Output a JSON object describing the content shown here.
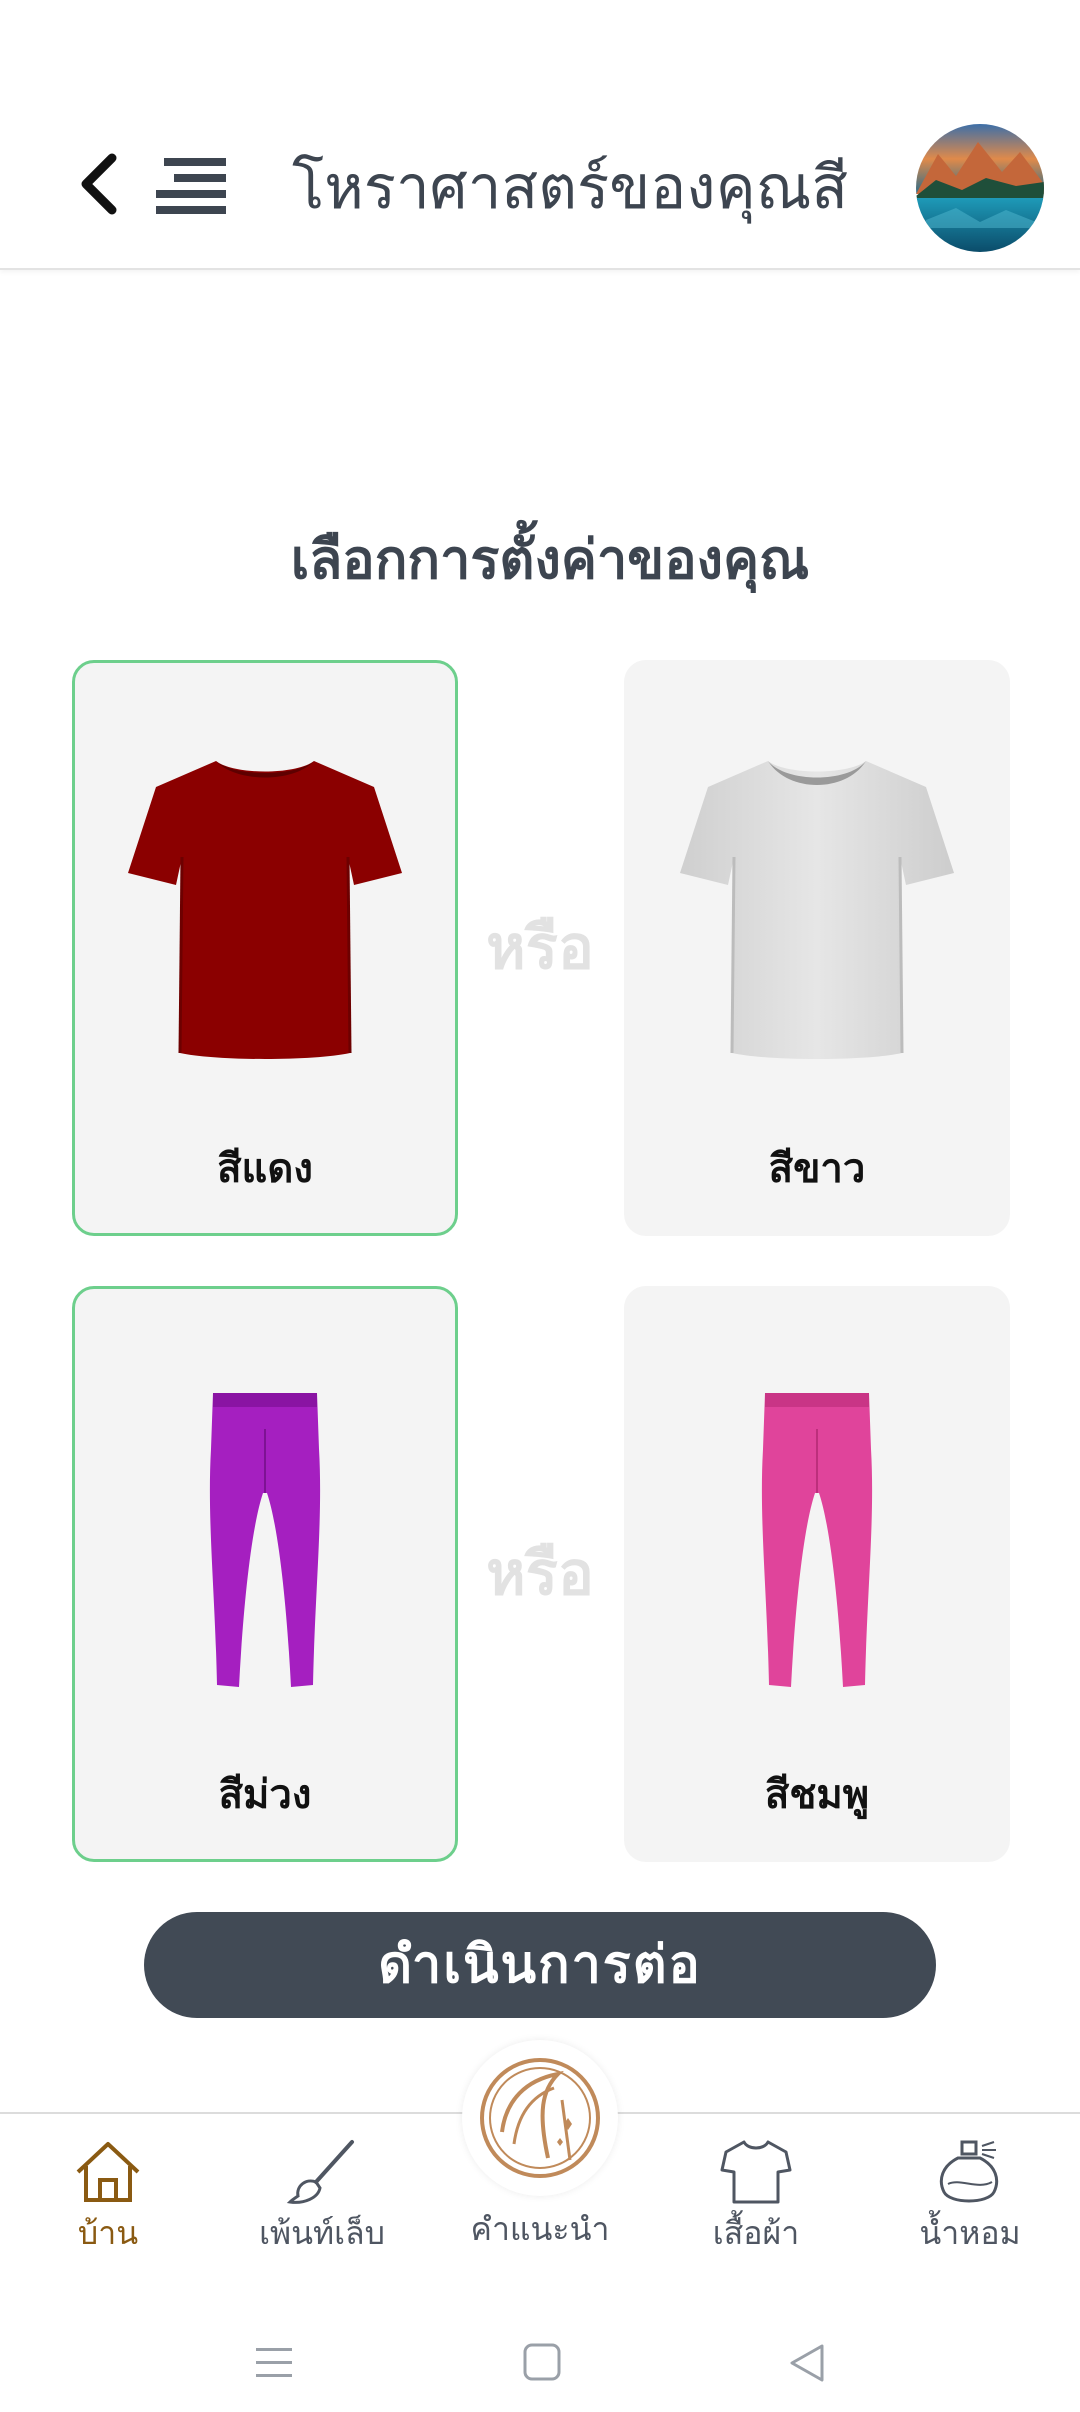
{
  "header": {
    "title": "โหราศาสตร์ของคุณสี"
  },
  "main": {
    "heading": "เลือกการตั้งค่าของคุณ",
    "or_text": "หรือ",
    "rows": [
      {
        "left": {
          "label": "สีแดง",
          "selected": true,
          "color": "#8b0000"
        },
        "right": {
          "label": "สีขาว",
          "selected": false,
          "color": "#e2e2e2"
        }
      },
      {
        "left": {
          "label": "สีม่วง",
          "selected": true,
          "color": "#a51fc0"
        },
        "right": {
          "label": "สีชมพู",
          "selected": false,
          "color": "#e0449b"
        }
      }
    ],
    "continue_label": "ดำเนินการต่อ"
  },
  "bottom_nav": {
    "items": [
      {
        "label": "บ้าน",
        "icon": "home-icon",
        "active": true
      },
      {
        "label": "เพ้นท์เล็บ",
        "icon": "brush-icon",
        "active": false
      },
      {
        "label": "คำแนะนำ",
        "icon": "advice-logo-icon",
        "active": false
      },
      {
        "label": "เสื้อผ้า",
        "icon": "shirt-icon",
        "active": false
      },
      {
        "label": "น้ำหอม",
        "icon": "perfume-icon",
        "active": false
      }
    ]
  },
  "colors": {
    "accent_selected": "#6dcf8c",
    "button_bg": "#414a55",
    "nav_active": "#8a5a12"
  }
}
